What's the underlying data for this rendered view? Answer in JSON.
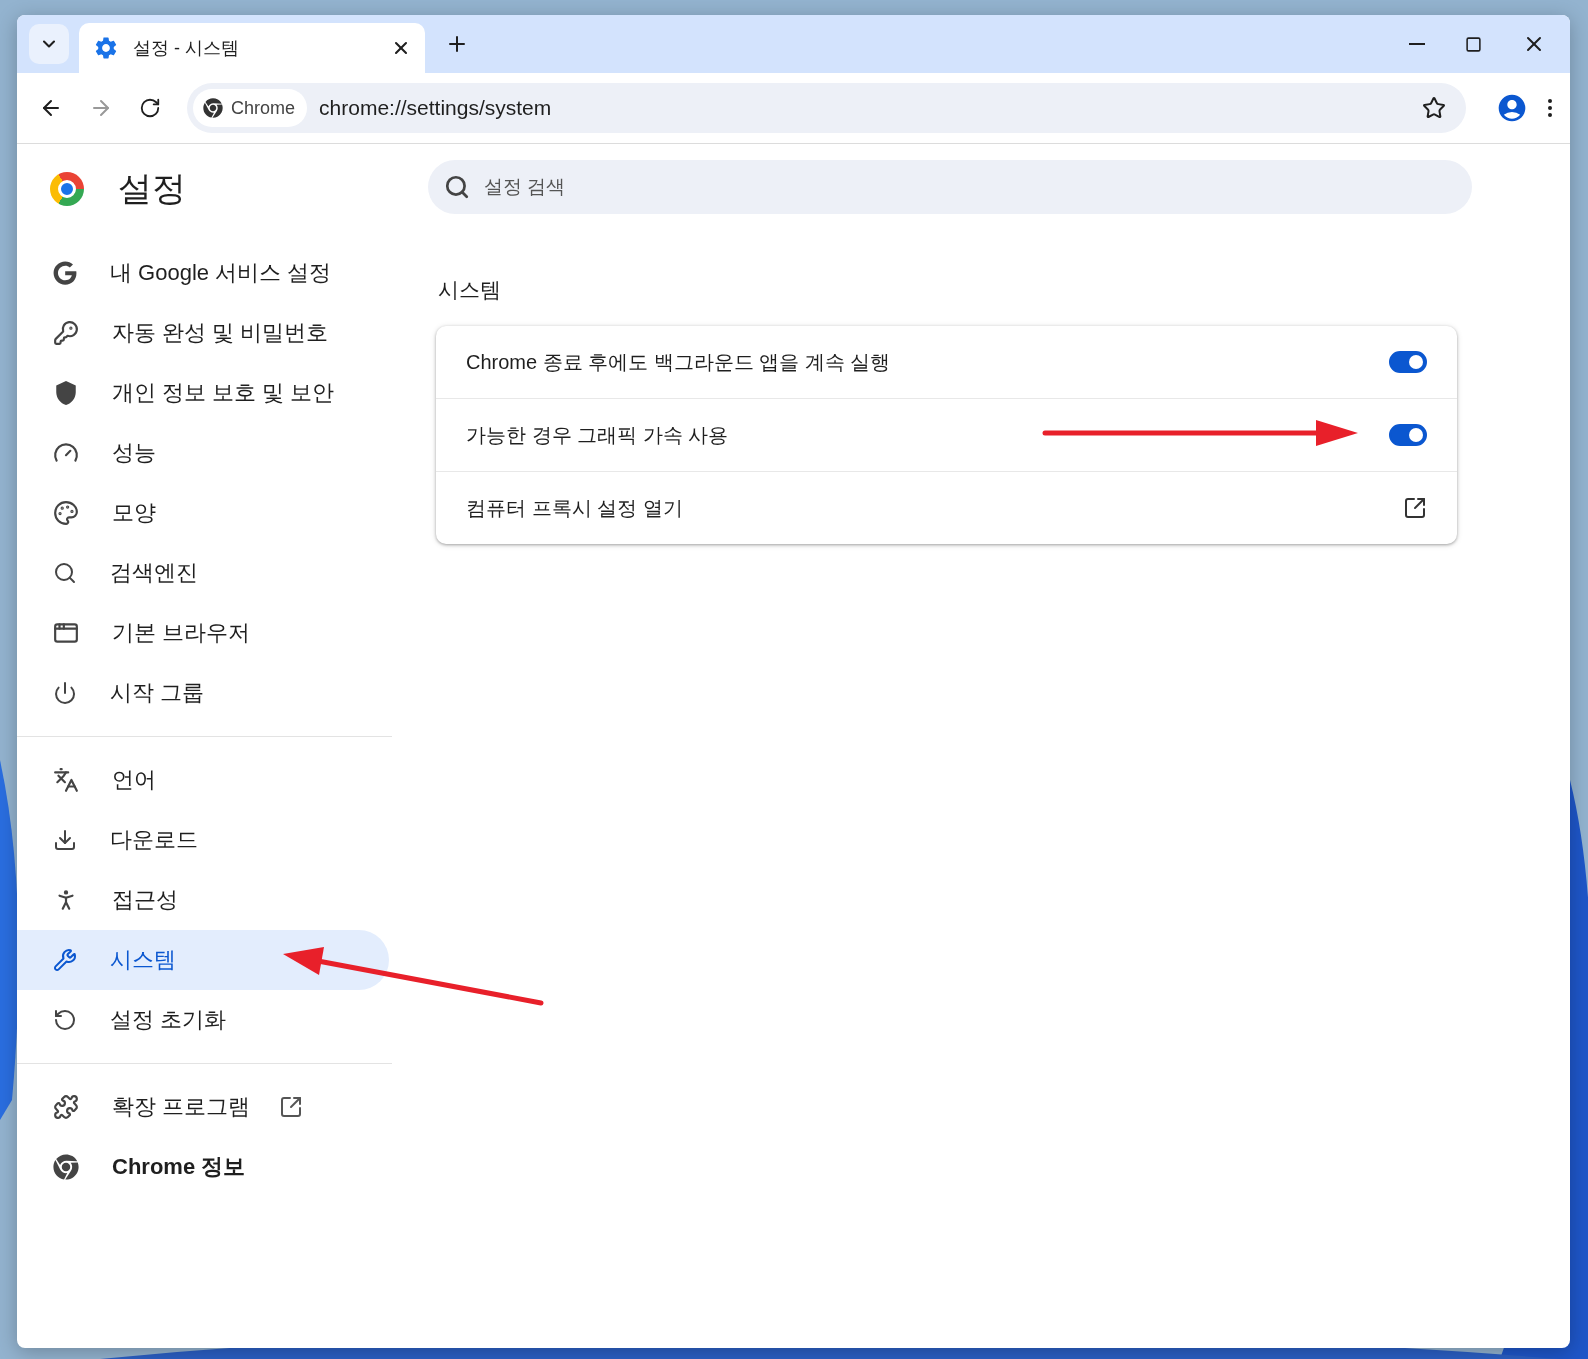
{
  "tab": {
    "title": "설정 - 시스템",
    "selected": true
  },
  "address_bar": {
    "chip": "Chrome",
    "url": "chrome://settings/system"
  },
  "header": {
    "title": "설정",
    "search": {
      "placeholder": "설정 검색"
    }
  },
  "sidebar": {
    "groups": [
      {
        "items": [
          {
            "label": "내 Google 서비스 설정",
            "selected": false
          },
          {
            "label": "자동 완성 및 비밀번호",
            "selected": false
          },
          {
            "label": "개인 정보 보호 및 보안",
            "selected": false
          },
          {
            "label": "성능",
            "selected": false
          },
          {
            "label": "모양",
            "selected": false
          },
          {
            "label": "검색엔진",
            "selected": false
          },
          {
            "label": "기본 브라우저",
            "selected": false
          },
          {
            "label": "시작 그룹",
            "selected": false
          }
        ]
      },
      {
        "items": [
          {
            "label": "언어",
            "selected": false
          },
          {
            "label": "다운로드",
            "selected": false
          },
          {
            "label": "접근성",
            "selected": false
          },
          {
            "label": "시스템",
            "selected": true
          },
          {
            "label": "설정 초기화",
            "selected": false
          }
        ]
      },
      {
        "items": [
          {
            "label": "확장 프로그램",
            "selected": false,
            "external": true
          },
          {
            "label": "Chrome 정보",
            "selected": false
          }
        ]
      }
    ]
  },
  "section": {
    "title": "시스템",
    "rows": [
      {
        "kind": "toggle",
        "label": "Chrome 종료 후에도 백그라운드 앱을 계속 실행",
        "on": true
      },
      {
        "kind": "toggle",
        "label": "가능한 경우 그래픽 가속 사용",
        "on": true
      },
      {
        "kind": "link",
        "label": "컴퓨터 프록시 설정 열기"
      }
    ]
  }
}
